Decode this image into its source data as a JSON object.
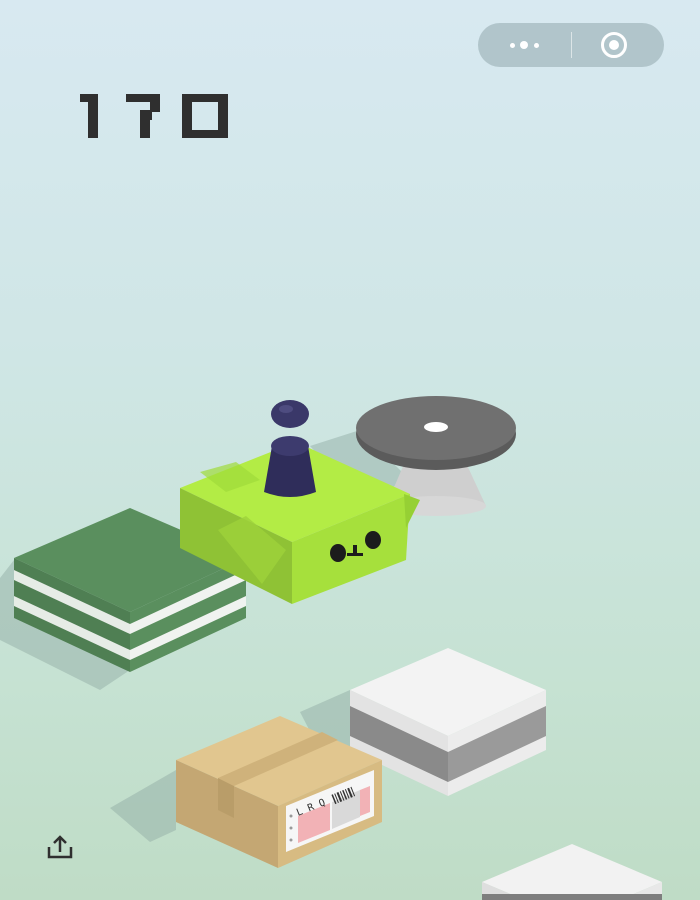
{
  "score": "170",
  "capsule": {
    "more_icon": "more-dots-icon",
    "close_icon": "target-circle-icon"
  },
  "share_icon": "share-upload-icon",
  "colors": {
    "bg_top": "#d8e9f1",
    "bg_bottom": "#bfdcc6",
    "score": "#2f2f2f",
    "green_cube": "#a8e23d",
    "dark_green_block": "#5a8f5e",
    "piece": "#34335e",
    "disc": "#6e6e6e",
    "box": "#dcc08a"
  }
}
